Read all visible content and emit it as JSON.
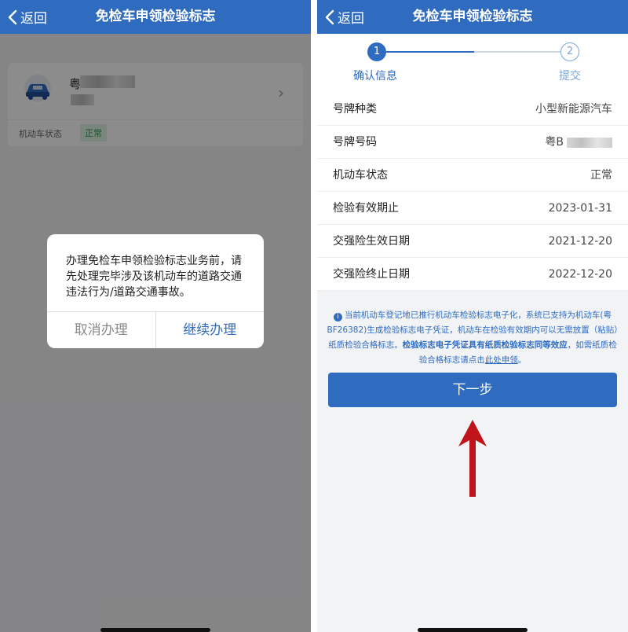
{
  "left_screen": {
    "nav": {
      "back_label": "返回",
      "title": "免检车申领检验标志"
    },
    "vehicle_card": {
      "plate_prefix": "粤B",
      "status_label": "机动车状态",
      "status_value": "正常"
    },
    "dialog": {
      "message": "办理免检车申领检验标志业务前，请先处理完毕涉及该机动车的道路交通违法行为/道路交通事故。",
      "cancel_label": "取消办理",
      "confirm_label": "继续办理"
    }
  },
  "right_screen": {
    "nav": {
      "back_label": "返回",
      "title": "免检车申领检验标志"
    },
    "steps": [
      {
        "number": "1",
        "label": "确认信息",
        "active": true
      },
      {
        "number": "2",
        "label": "提交",
        "active": false
      }
    ],
    "info_rows": [
      {
        "key": "号牌种类",
        "value": "小型新能源汽车"
      },
      {
        "key": "号牌号码",
        "value": "粤B"
      },
      {
        "key": "机动车状态",
        "value": "正常"
      },
      {
        "key": "检验有效期止",
        "value": "2023-01-31"
      },
      {
        "key": "交强险生效日期",
        "value": "2021-12-20"
      },
      {
        "key": "交强险终止日期",
        "value": "2022-12-20"
      }
    ],
    "notice": {
      "icon": "i",
      "part1": "当前机动车登记地已推行机动车检验标志电子化，系统已支持为机动车(粤BF26382)生成检验标志电子凭证，机动车在检验有效期内可以无需放置（粘贴）纸质检验合格标志。",
      "part2_bold": "检验标志电子凭证具有纸质检验标志同等效应",
      "part3": "，如需纸质检验合格标志请点击",
      "link": "此处申领",
      "part4": "。"
    },
    "next_button_label": "下一步"
  },
  "colors": {
    "brand_blue": "#2f6cc0",
    "status_green": "#2e9b4f",
    "annotation_arrow": "#c0141b"
  }
}
